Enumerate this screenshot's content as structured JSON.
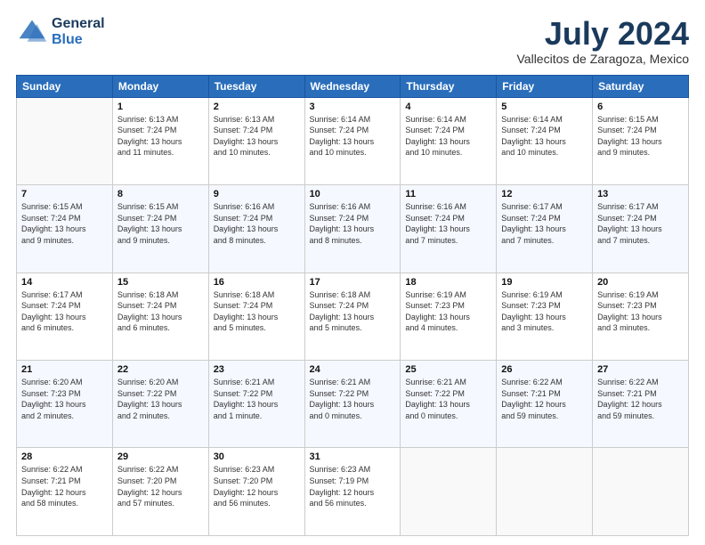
{
  "logo": {
    "line1": "General",
    "line2": "Blue"
  },
  "header": {
    "title": "July 2024",
    "subtitle": "Vallecitos de Zaragoza, Mexico"
  },
  "columns": [
    "Sunday",
    "Monday",
    "Tuesday",
    "Wednesday",
    "Thursday",
    "Friday",
    "Saturday"
  ],
  "weeks": [
    [
      {
        "day": "",
        "info": ""
      },
      {
        "day": "1",
        "info": "Sunrise: 6:13 AM\nSunset: 7:24 PM\nDaylight: 13 hours\nand 11 minutes."
      },
      {
        "day": "2",
        "info": "Sunrise: 6:13 AM\nSunset: 7:24 PM\nDaylight: 13 hours\nand 10 minutes."
      },
      {
        "day": "3",
        "info": "Sunrise: 6:14 AM\nSunset: 7:24 PM\nDaylight: 13 hours\nand 10 minutes."
      },
      {
        "day": "4",
        "info": "Sunrise: 6:14 AM\nSunset: 7:24 PM\nDaylight: 13 hours\nand 10 minutes."
      },
      {
        "day": "5",
        "info": "Sunrise: 6:14 AM\nSunset: 7:24 PM\nDaylight: 13 hours\nand 10 minutes."
      },
      {
        "day": "6",
        "info": "Sunrise: 6:15 AM\nSunset: 7:24 PM\nDaylight: 13 hours\nand 9 minutes."
      }
    ],
    [
      {
        "day": "7",
        "info": "Sunrise: 6:15 AM\nSunset: 7:24 PM\nDaylight: 13 hours\nand 9 minutes."
      },
      {
        "day": "8",
        "info": "Sunrise: 6:15 AM\nSunset: 7:24 PM\nDaylight: 13 hours\nand 9 minutes."
      },
      {
        "day": "9",
        "info": "Sunrise: 6:16 AM\nSunset: 7:24 PM\nDaylight: 13 hours\nand 8 minutes."
      },
      {
        "day": "10",
        "info": "Sunrise: 6:16 AM\nSunset: 7:24 PM\nDaylight: 13 hours\nand 8 minutes."
      },
      {
        "day": "11",
        "info": "Sunrise: 6:16 AM\nSunset: 7:24 PM\nDaylight: 13 hours\nand 7 minutes."
      },
      {
        "day": "12",
        "info": "Sunrise: 6:17 AM\nSunset: 7:24 PM\nDaylight: 13 hours\nand 7 minutes."
      },
      {
        "day": "13",
        "info": "Sunrise: 6:17 AM\nSunset: 7:24 PM\nDaylight: 13 hours\nand 7 minutes."
      }
    ],
    [
      {
        "day": "14",
        "info": "Sunrise: 6:17 AM\nSunset: 7:24 PM\nDaylight: 13 hours\nand 6 minutes."
      },
      {
        "day": "15",
        "info": "Sunrise: 6:18 AM\nSunset: 7:24 PM\nDaylight: 13 hours\nand 6 minutes."
      },
      {
        "day": "16",
        "info": "Sunrise: 6:18 AM\nSunset: 7:24 PM\nDaylight: 13 hours\nand 5 minutes."
      },
      {
        "day": "17",
        "info": "Sunrise: 6:18 AM\nSunset: 7:24 PM\nDaylight: 13 hours\nand 5 minutes."
      },
      {
        "day": "18",
        "info": "Sunrise: 6:19 AM\nSunset: 7:23 PM\nDaylight: 13 hours\nand 4 minutes."
      },
      {
        "day": "19",
        "info": "Sunrise: 6:19 AM\nSunset: 7:23 PM\nDaylight: 13 hours\nand 3 minutes."
      },
      {
        "day": "20",
        "info": "Sunrise: 6:19 AM\nSunset: 7:23 PM\nDaylight: 13 hours\nand 3 minutes."
      }
    ],
    [
      {
        "day": "21",
        "info": "Sunrise: 6:20 AM\nSunset: 7:23 PM\nDaylight: 13 hours\nand 2 minutes."
      },
      {
        "day": "22",
        "info": "Sunrise: 6:20 AM\nSunset: 7:22 PM\nDaylight: 13 hours\nand 2 minutes."
      },
      {
        "day": "23",
        "info": "Sunrise: 6:21 AM\nSunset: 7:22 PM\nDaylight: 13 hours\nand 1 minute."
      },
      {
        "day": "24",
        "info": "Sunrise: 6:21 AM\nSunset: 7:22 PM\nDaylight: 13 hours\nand 0 minutes."
      },
      {
        "day": "25",
        "info": "Sunrise: 6:21 AM\nSunset: 7:22 PM\nDaylight: 13 hours\nand 0 minutes."
      },
      {
        "day": "26",
        "info": "Sunrise: 6:22 AM\nSunset: 7:21 PM\nDaylight: 12 hours\nand 59 minutes."
      },
      {
        "day": "27",
        "info": "Sunrise: 6:22 AM\nSunset: 7:21 PM\nDaylight: 12 hours\nand 59 minutes."
      }
    ],
    [
      {
        "day": "28",
        "info": "Sunrise: 6:22 AM\nSunset: 7:21 PM\nDaylight: 12 hours\nand 58 minutes."
      },
      {
        "day": "29",
        "info": "Sunrise: 6:22 AM\nSunset: 7:20 PM\nDaylight: 12 hours\nand 57 minutes."
      },
      {
        "day": "30",
        "info": "Sunrise: 6:23 AM\nSunset: 7:20 PM\nDaylight: 12 hours\nand 56 minutes."
      },
      {
        "day": "31",
        "info": "Sunrise: 6:23 AM\nSunset: 7:19 PM\nDaylight: 12 hours\nand 56 minutes."
      },
      {
        "day": "",
        "info": ""
      },
      {
        "day": "",
        "info": ""
      },
      {
        "day": "",
        "info": ""
      }
    ]
  ]
}
